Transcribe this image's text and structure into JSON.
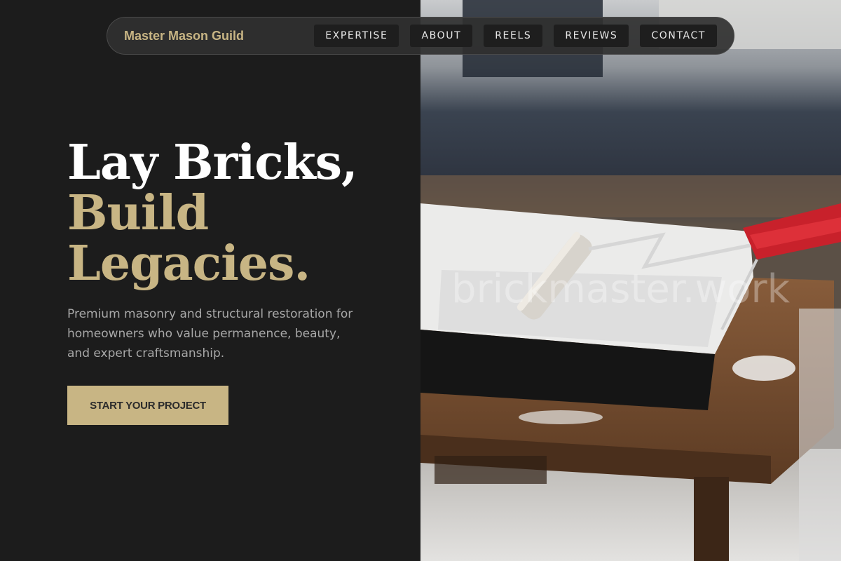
{
  "navbar": {
    "brand": "Master Mason Guild",
    "items": [
      {
        "label": "EXPERTISE"
      },
      {
        "label": "ABOUT"
      },
      {
        "label": "REELS"
      },
      {
        "label": "REVIEWS"
      },
      {
        "label": "CONTACT"
      }
    ]
  },
  "hero": {
    "title_line1": "Lay Bricks,",
    "title_line2": "Build",
    "title_line3": "Legacies.",
    "description": "Premium masonry and structural restoration for homeowners who value permanence, beauty, and expert craftsmanship.",
    "cta_label": "START YOUR PROJECT"
  },
  "image": {
    "watermark": "brickmaster.work",
    "alt": "paint tray with roller on a wooden table"
  },
  "colors": {
    "background": "#1c1c1c",
    "accent": "#c8b584",
    "text_muted": "#a8a8a8"
  }
}
